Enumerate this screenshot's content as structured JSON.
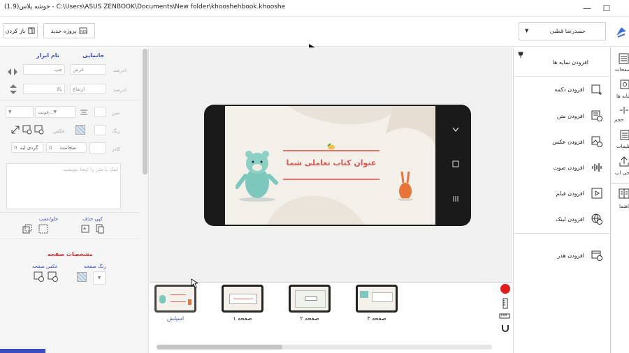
{
  "window": {
    "title": "خوشه پلاس(1.9) - C:\\Users\\ASUS ZENBOOK\\Documents\\New folder\\khooshehbook.khooshe",
    "minimize": "—",
    "maximize": "☐"
  },
  "toolbar": {
    "open_label": "باز کردن",
    "new_project_label": "پروژه جدید",
    "user_name": "حمیدرضا قطبی"
  },
  "left": {
    "pos_header": "جانمایی",
    "tool_header": "نام ابزار",
    "width_label": "عرض",
    "percent_x": "درصد٪",
    "right_label": "چپ",
    "height_label": "ارتفاع",
    "percent_y": "درصد٪",
    "top_label": "بالا",
    "text_label": "متن",
    "font_placeholder": "فونت...",
    "color_label": "رنگ",
    "image_label": "عکس",
    "border_label": "کادر",
    "thickness_label": "ضخامت",
    "thickness_value": "0",
    "radius_label": "گردی لبه",
    "radius_value": "0",
    "textarea_placeholder": "لینک یا متن را اینجا بنویسید",
    "copy_delete": "کپی  حذف",
    "front_back": "جلو/عقب",
    "page_props": "مشخصات صفحه",
    "page_color": "رنگ صفحه",
    "page_image": "عکس صفحه"
  },
  "slide": {
    "title": "عنوان کتاب تعاملی شما"
  },
  "thumbnails": [
    {
      "label": "اسپلش"
    },
    {
      "label": "صفحه ۱"
    },
    {
      "label": "صفحه ۲"
    },
    {
      "label": "صفحه ۳"
    }
  ],
  "right": {
    "add_view": "افزودن نمایه ها",
    "items": [
      {
        "label": "افزودن دکمه",
        "icon": "button-add-icon"
      },
      {
        "label": "افزودن متن",
        "icon": "text-add-icon"
      },
      {
        "label": "افزودن عکس",
        "icon": "image-add-icon"
      },
      {
        "label": "افزودن صوت",
        "icon": "audio-add-icon"
      },
      {
        "label": "افزودن فیلم",
        "icon": "video-add-icon"
      },
      {
        "label": "افزودن لینک",
        "icon": "link-add-icon"
      }
    ],
    "add_header": "افزودن هدر"
  },
  "fartabs": [
    {
      "label": "صفحات"
    },
    {
      "label": "نمایه ها"
    },
    {
      "label": "حجم"
    },
    {
      "label": "تنظیمات"
    },
    {
      "label": "خروجی اپ"
    },
    {
      "label": "راهنما"
    }
  ],
  "colors": {
    "accent": "#3b4cc0",
    "title_red": "#e0554f",
    "record": "#e21d1d"
  }
}
